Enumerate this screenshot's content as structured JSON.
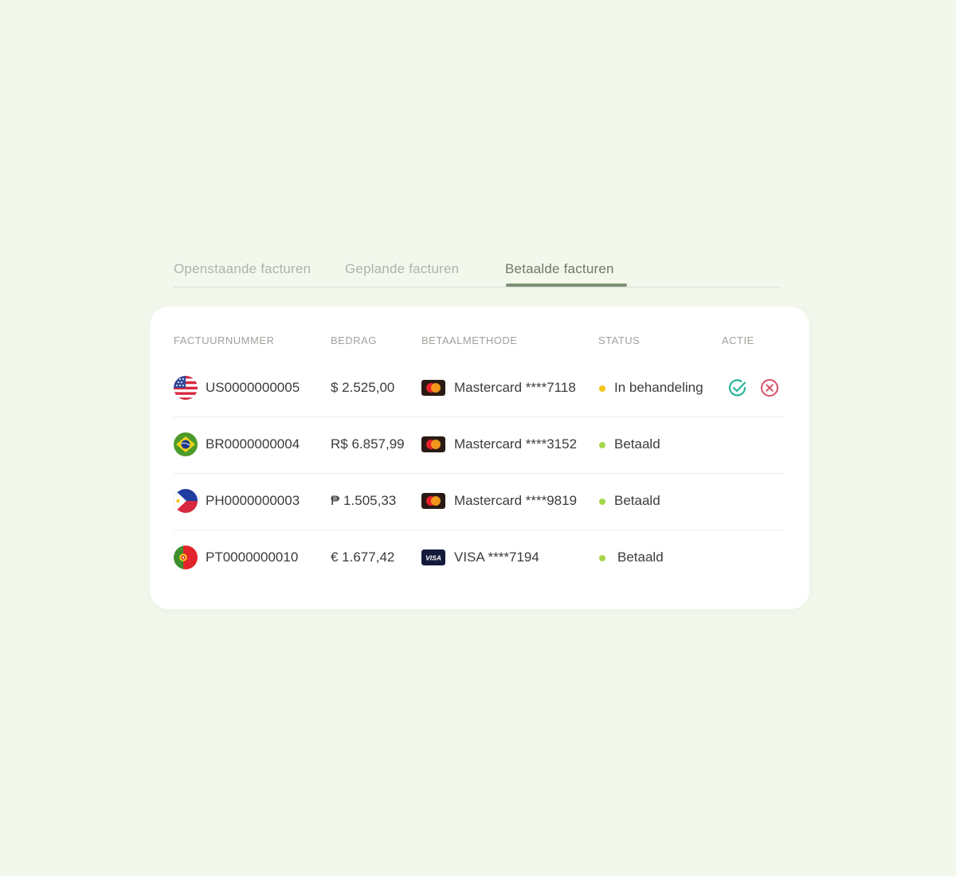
{
  "tabs": [
    {
      "label": "Openstaande facturen"
    },
    {
      "label": "Geplande facturen"
    },
    {
      "label": "Betaalde facturen"
    }
  ],
  "active_tab": "Betaalde facturen",
  "table": {
    "headers": {
      "invoice": "FACTUURNUMMER",
      "amount": "BEDRAG",
      "method": "BETAALMETHODE",
      "status": "STATUS",
      "action": "ACTIE"
    },
    "rows": [
      {
        "flag": "us-flag-icon",
        "invoice": "US0000000005",
        "amount": "$ 2.525,00",
        "card": "mastercard-icon",
        "method": "Mastercard ****7118",
        "status": "In behandeling",
        "status_color": "#f5c518",
        "actions": [
          "approve-icon",
          "reject-icon"
        ]
      },
      {
        "flag": "br-flag-icon",
        "invoice": "BR0000000004",
        "amount": "R$ 6.857,99",
        "card": "mastercard-icon",
        "method": "Mastercard ****3152",
        "status": "Betaald",
        "status_color": "#a5d64a"
      },
      {
        "flag": "ph-flag-icon",
        "invoice": "PH0000000003",
        "amount": "₱ 1.505,33",
        "card": "mastercard-icon",
        "method": "Mastercard ****9819",
        "status": "Betaald",
        "status_color": "#a5d64a"
      },
      {
        "flag": "pt-flag-icon",
        "invoice": "PT0000000010",
        "amount": "€ 1.677,42",
        "card": "visa-icon",
        "card_text": "VISA",
        "method": "VISA ****7194",
        "status": "Betaald",
        "status_color": "#a5d64a"
      }
    ]
  },
  "colors": {
    "background": "#f2f8ec",
    "active_tab_underline": "#7e9276",
    "approve": "#2bb39a",
    "reject": "#d9506a"
  }
}
